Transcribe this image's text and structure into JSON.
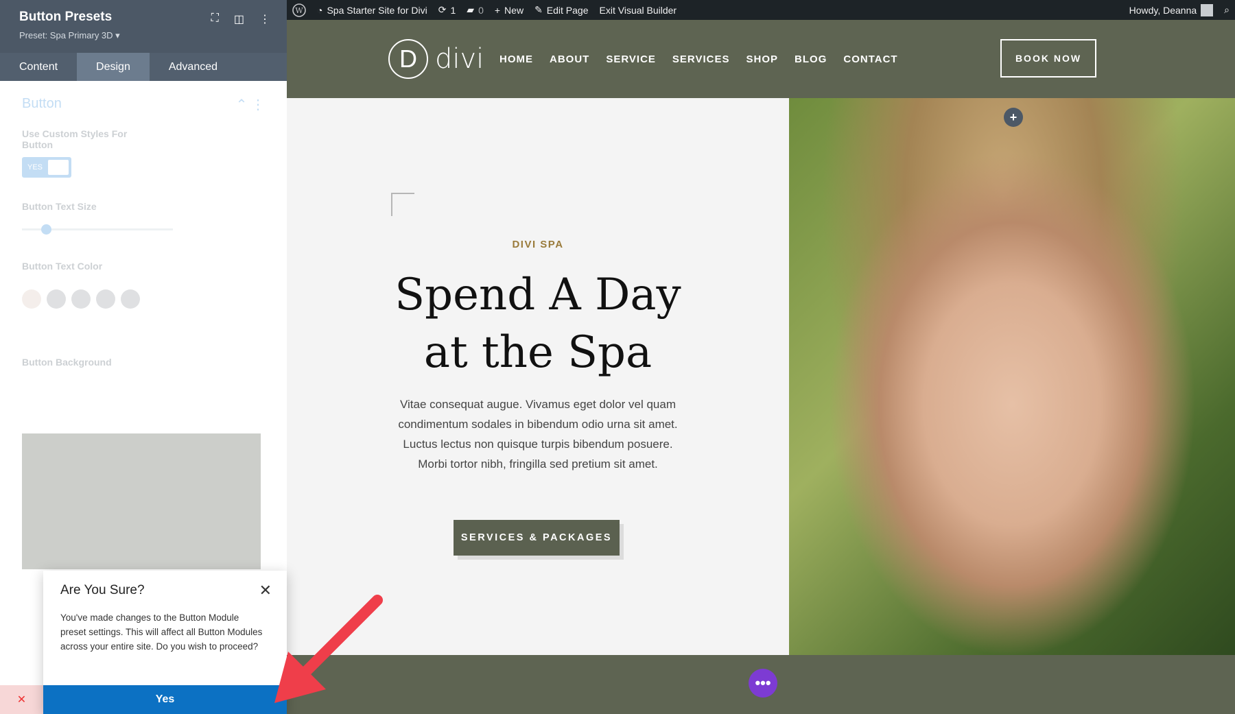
{
  "admin_bar": {
    "site_name": "Spa Starter Site for Divi",
    "updates_count": "1",
    "comments_count": "0",
    "new_label": "New",
    "edit_page_label": "Edit Page",
    "exit_builder_label": "Exit Visual Builder",
    "greeting": "Howdy, Deanna"
  },
  "panel": {
    "title": "Button Presets",
    "preset": "Preset: Spa Primary 3D ▾",
    "tabs": [
      "Content",
      "Design",
      "Advanced"
    ],
    "section_title": "Button",
    "custom_styles_label": "Use Custom Styles For Button",
    "toggle_value": "YES",
    "text_size_label": "Button Text Size",
    "text_color_label": "Button Text Color",
    "background_label": "Button Background"
  },
  "dialog": {
    "title": "Are You Sure?",
    "message": "You've made changes to the Button Module preset settings. This will affect all Button Modules across your entire site. Do you wish to proceed?",
    "yes_label": "Yes"
  },
  "site": {
    "logo_letter": "D",
    "logo_word": "divi",
    "nav": [
      "HOME",
      "ABOUT",
      "SERVICE",
      "SERVICES",
      "SHOP",
      "BLOG",
      "CONTACT"
    ],
    "book_label": "BOOK NOW",
    "eyebrow": "DIVI SPA",
    "headline_line1": "Spend A Day",
    "headline_line2": "at the Spa",
    "body": "Vitae consequat augue. Vivamus eget dolor vel quam condimentum sodales in bibendum odio urna sit amet. Luctus lectus non quisque turpis bibendum posuere. Morbi tortor nibh, fringilla sed pretium sit amet.",
    "cta_label": "SERVICES & PACKAGES"
  },
  "colors": {
    "header_green": "#5e6452",
    "accent_blue": "#0c71c3",
    "eyebrow_gold": "#9a7b3b",
    "builder_purple": "#7d3bd3",
    "arrow_red": "#ef3e4a"
  }
}
